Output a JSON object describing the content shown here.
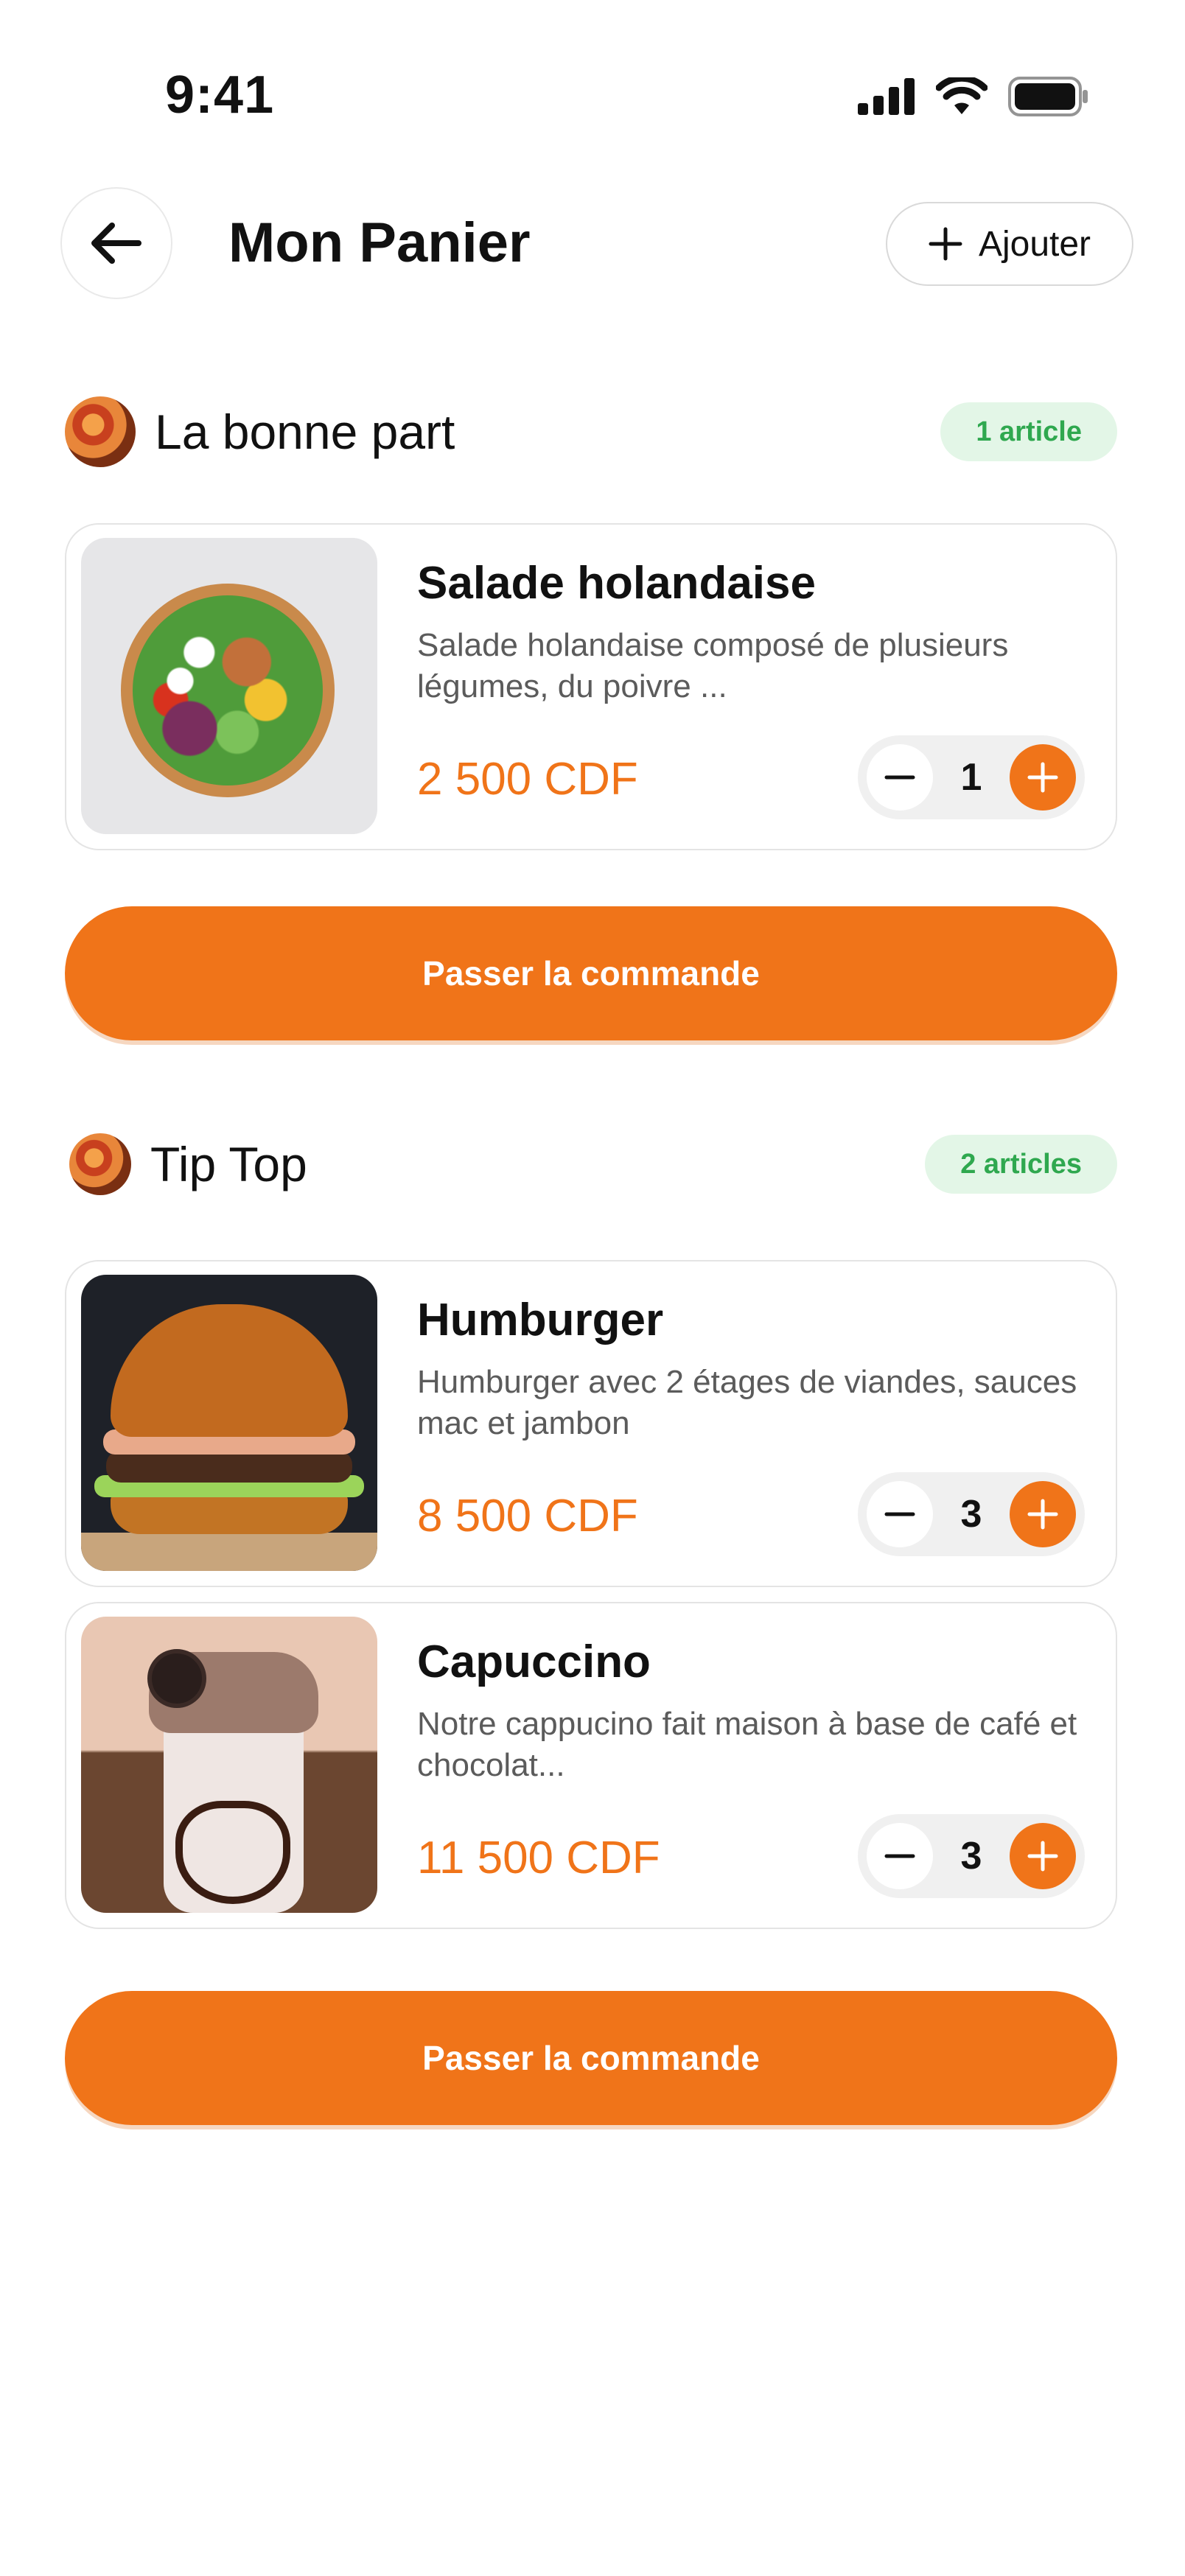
{
  "status_bar": {
    "time": "9:41",
    "icons": [
      "signal-icon",
      "wifi-icon",
      "battery-icon"
    ]
  },
  "header": {
    "title": "Mon Panier",
    "back_icon": "arrow-left-icon",
    "add_label": "Ajouter",
    "add_icon": "plus-icon"
  },
  "colors": {
    "accent": "#F07419",
    "badge_bg": "#E3F6E7",
    "badge_text": "#2FA84F",
    "muted_text": "#5B5B5B"
  },
  "restaurants": [
    {
      "name": "La bonne part",
      "badge": "1 article",
      "order_label": "Passer la commande",
      "items": [
        {
          "name": "Salade holandaise",
          "desc": "Salade holandaise composé de plusieurs légumes, du poivre ...",
          "price": "2 500 CDF",
          "qty": "1"
        }
      ]
    },
    {
      "name": "Tip Top",
      "badge": "2 articles",
      "order_label": "Passer la commande",
      "items": [
        {
          "name": "Humburger",
          "desc": "Humburger avec 2 étages de viandes, sauces mac et jambon",
          "price": "8 500 CDF",
          "qty": "3"
        },
        {
          "name": "Capuccino",
          "desc": "Notre cappucino fait maison à base de café et chocolat...",
          "price": "11 500 CDF",
          "qty": "3"
        }
      ]
    }
  ]
}
